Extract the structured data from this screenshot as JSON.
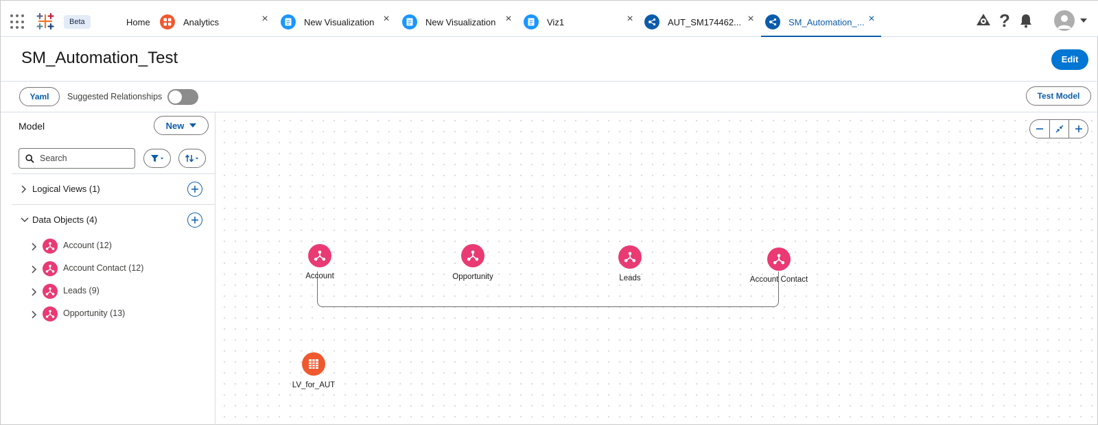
{
  "topbar": {
    "beta_badge": "Beta",
    "tabs": [
      {
        "label": "Home",
        "icon": "none"
      },
      {
        "label": "Analytics",
        "icon": "analytics-icon",
        "color": "#f0582e"
      },
      {
        "label": "New Visualization",
        "icon": "visualization-icon",
        "color": "#1b96ff"
      },
      {
        "label": "New Visualization",
        "icon": "visualization-icon",
        "color": "#1b96ff"
      },
      {
        "label": "Viz1",
        "icon": "visualization-icon",
        "color": "#1b96ff"
      },
      {
        "label": "AUT_SM174462...",
        "icon": "semantic-model-icon",
        "color": "#0b5cab"
      },
      {
        "label": "SM_Automation_...",
        "icon": "semantic-model-icon",
        "color": "#0b5cab",
        "active": true
      }
    ],
    "right_icons": [
      "setup-icon",
      "help-icon",
      "notifications-icon",
      "avatar"
    ]
  },
  "header": {
    "title": "SM_Automation_Test",
    "edit_label": "Edit"
  },
  "toolbar": {
    "yaml_label": "Yaml",
    "suggested_label": "Suggested Relationships",
    "suggested_on": false,
    "test_model_label": "Test Model"
  },
  "sidebar": {
    "model_label": "Model",
    "new_label": "New",
    "search_placeholder": "Search",
    "logical_views_label": "Logical Views (1)",
    "data_objects_label": "Data Objects (4)",
    "data_objects": [
      {
        "label": "Account (12)"
      },
      {
        "label": "Account Contact (12)"
      },
      {
        "label": "Leads (9)"
      },
      {
        "label": "Opportunity (13)"
      }
    ]
  },
  "canvas": {
    "nodes": [
      {
        "label": "Account",
        "type": "data-object"
      },
      {
        "label": "Opportunity",
        "type": "data-object"
      },
      {
        "label": "Leads",
        "type": "data-object"
      },
      {
        "label": "Account Contact",
        "type": "data-object"
      },
      {
        "label": "LV_for_AUT",
        "type": "logical-view"
      }
    ],
    "relationship": [
      "Account",
      "Account Contact"
    ],
    "colors": {
      "data_object": "#e93a74",
      "logical_view": "#f0582e",
      "accent": "#0176d3"
    }
  }
}
